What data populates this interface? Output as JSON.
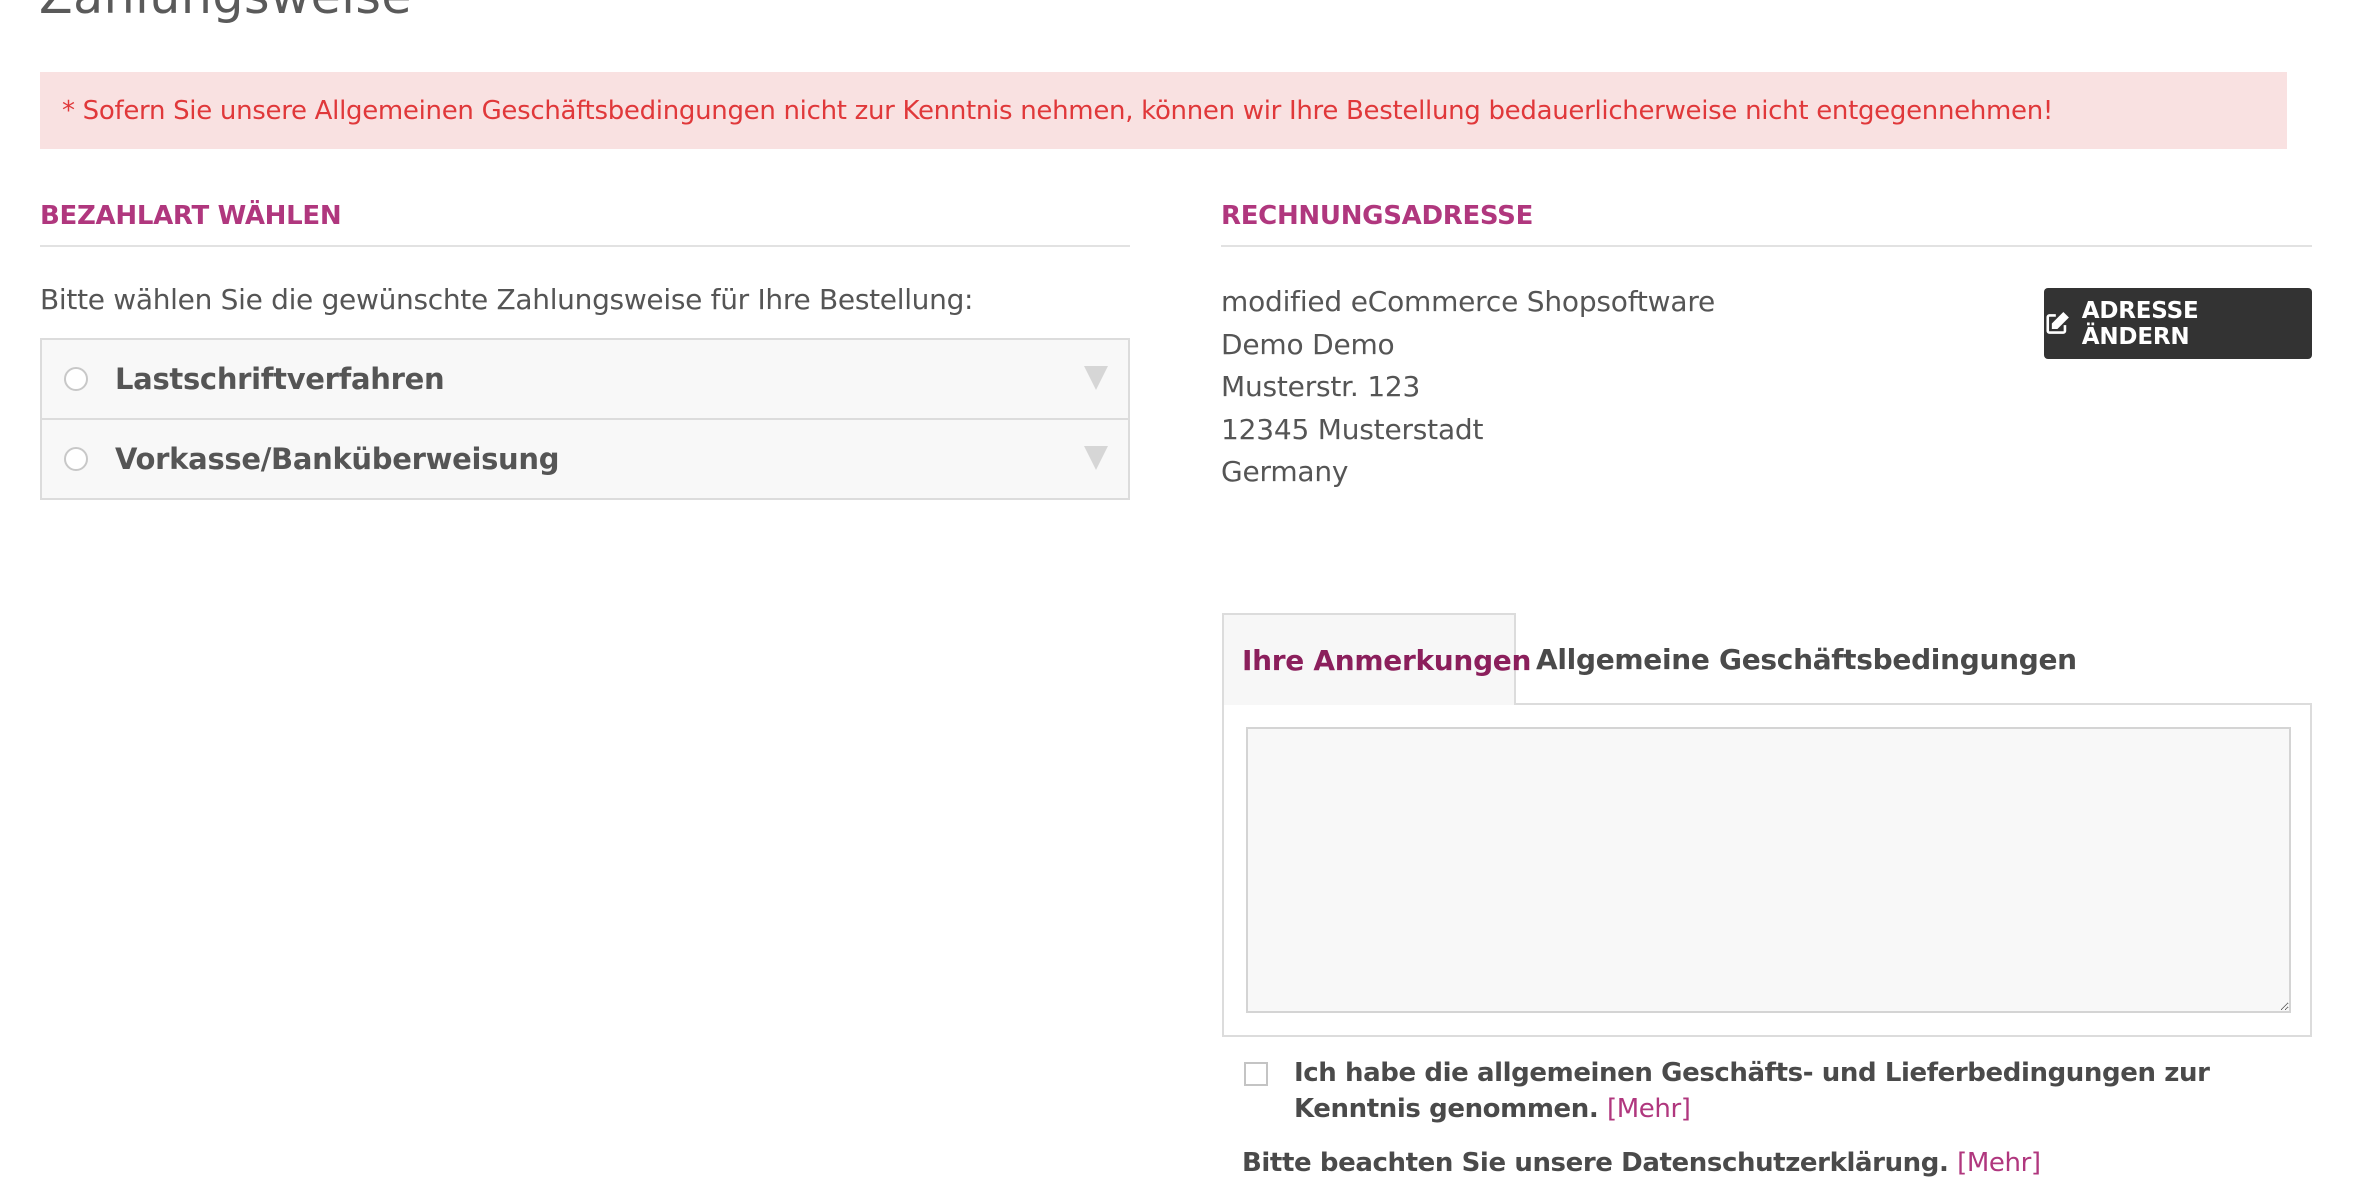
{
  "page_title": "Zahlungsweise",
  "alert": {
    "text": "* Sofern Sie unsere Allgemeinen Geschäftsbedingungen nicht zur Kenntnis nehmen, können wir Ihre Bestellung bedauerlicherweise nicht entgegennehmen!",
    "color": "#e0383a",
    "background": "#f9e1e1"
  },
  "payment": {
    "heading": "BEZAHLART WÄHLEN",
    "intro": "Bitte wählen Sie die gewünschte Zahlungsweise für Ihre Bestellung:",
    "options": [
      {
        "label": "Lastschriftverfahren",
        "selected": false
      },
      {
        "label": "Vorkasse/Banküberweisung",
        "selected": false
      }
    ]
  },
  "billing": {
    "heading": "RECHNUNGSADRESSE",
    "address_lines": [
      "modified eCommerce Shopsoftware",
      "Demo Demo",
      "Musterstr. 123",
      "12345 Musterstadt",
      "Germany"
    ],
    "change_button_label": "ADRESSE ÄNDERN",
    "change_button_icon": "edit-icon"
  },
  "tabs": {
    "items": [
      {
        "label": "Ihre Anmerkungen",
        "active": true
      },
      {
        "label": "Allgemeine Geschäftsbedingungen",
        "active": false
      }
    ],
    "comments_value": ""
  },
  "terms": {
    "checkbox_checked": false,
    "text": "Ich habe die allgemeinen Geschäfts- und Lieferbedingungen zur Kenntnis genommen.",
    "more_link": "[Mehr]",
    "privacy_text": "Bitte beachten Sie unsere Datenschutzerklärung.",
    "privacy_more_link": "[Mehr]"
  },
  "colors": {
    "accent": "#b0377e",
    "active_tab": "#8b1f5c",
    "button_bg": "#333333"
  }
}
